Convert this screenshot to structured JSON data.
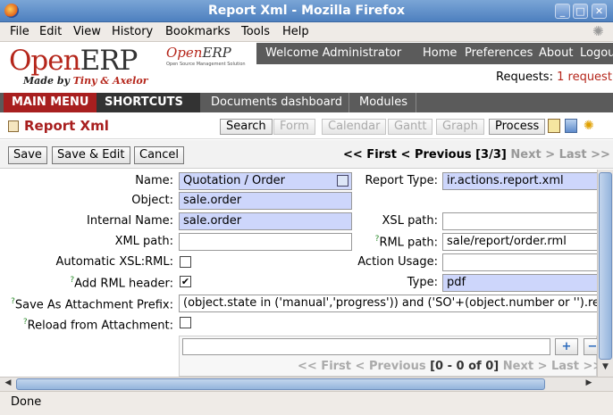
{
  "window": {
    "title": "Report Xml - Mozilla Firefox"
  },
  "menubar": [
    "File",
    "Edit",
    "View",
    "History",
    "Bookmarks",
    "Tools",
    "Help"
  ],
  "header": {
    "logo_open": "Open",
    "logo_erp": "ERP",
    "logo_tagline_prefix": "Made by ",
    "logo_tagline_brand": "Tiny & Axelor",
    "logo2_open": "Open",
    "logo2_erp": "ERP",
    "logo2_sub": "Open Source Management Solution",
    "welcome": "Welcome Administrator",
    "links": [
      "Home",
      "Preferences",
      "About",
      "Logout"
    ],
    "requests_label": "Requests:",
    "requests_value": "1 request"
  },
  "nav": {
    "main_menu": "MAIN MENU",
    "shortcuts": "SHORTCUTS",
    "documents_dashboard": "Documents dashboard",
    "modules": "Modules"
  },
  "view": {
    "title": "Report Xml",
    "modes": {
      "search": "Search",
      "form": "Form",
      "calendar": "Calendar",
      "gantt": "Gantt",
      "graph": "Graph"
    },
    "process": "Process"
  },
  "toolbar": {
    "save": "Save",
    "save_edit": "Save & Edit",
    "cancel": "Cancel"
  },
  "pager": {
    "first": "<< First",
    "previous": "< Previous",
    "count": "[3/3]",
    "next": "Next >",
    "last": "Last >>"
  },
  "form": {
    "name_label": "Name:",
    "name_value": "Quotation / Order",
    "report_type_label": "Report Type:",
    "report_type_value": "ir.actions.report.xml",
    "object_label": "Object:",
    "object_value": "sale.order",
    "internal_name_label": "Internal Name:",
    "internal_name_value": "sale.order",
    "xsl_path_label": "XSL path:",
    "xsl_path_value": "",
    "xml_path_label": "XML path:",
    "xml_path_value": "",
    "rml_path_label": "RML path:",
    "rml_path_value": "sale/report/order.rml",
    "auto_xsl_label": "Automatic XSL:RML:",
    "action_usage_label": "Action Usage:",
    "action_usage_value": "",
    "add_rml_header_label": "Add RML header:",
    "type_label": "Type:",
    "type_value": "pdf",
    "save_attachment_label": "Save As Attachment Prefix:",
    "save_attachment_value": "(object.state in ('manual','progress')) and ('SO'+(object.number or '').repla",
    "reload_label": "Reload from Attachment:",
    "help_mark": "?"
  },
  "o2m": {
    "pager": {
      "first": "<< First",
      "previous": "< Previous",
      "count": "[0 - 0 of 0]",
      "next": "Next >",
      "last": "Last >>"
    }
  },
  "status": {
    "text": "Done"
  },
  "colors": {
    "brand_red": "#a81f1f",
    "required_bg": "#cdd6fb",
    "nav_bg": "#5b5b5b"
  }
}
